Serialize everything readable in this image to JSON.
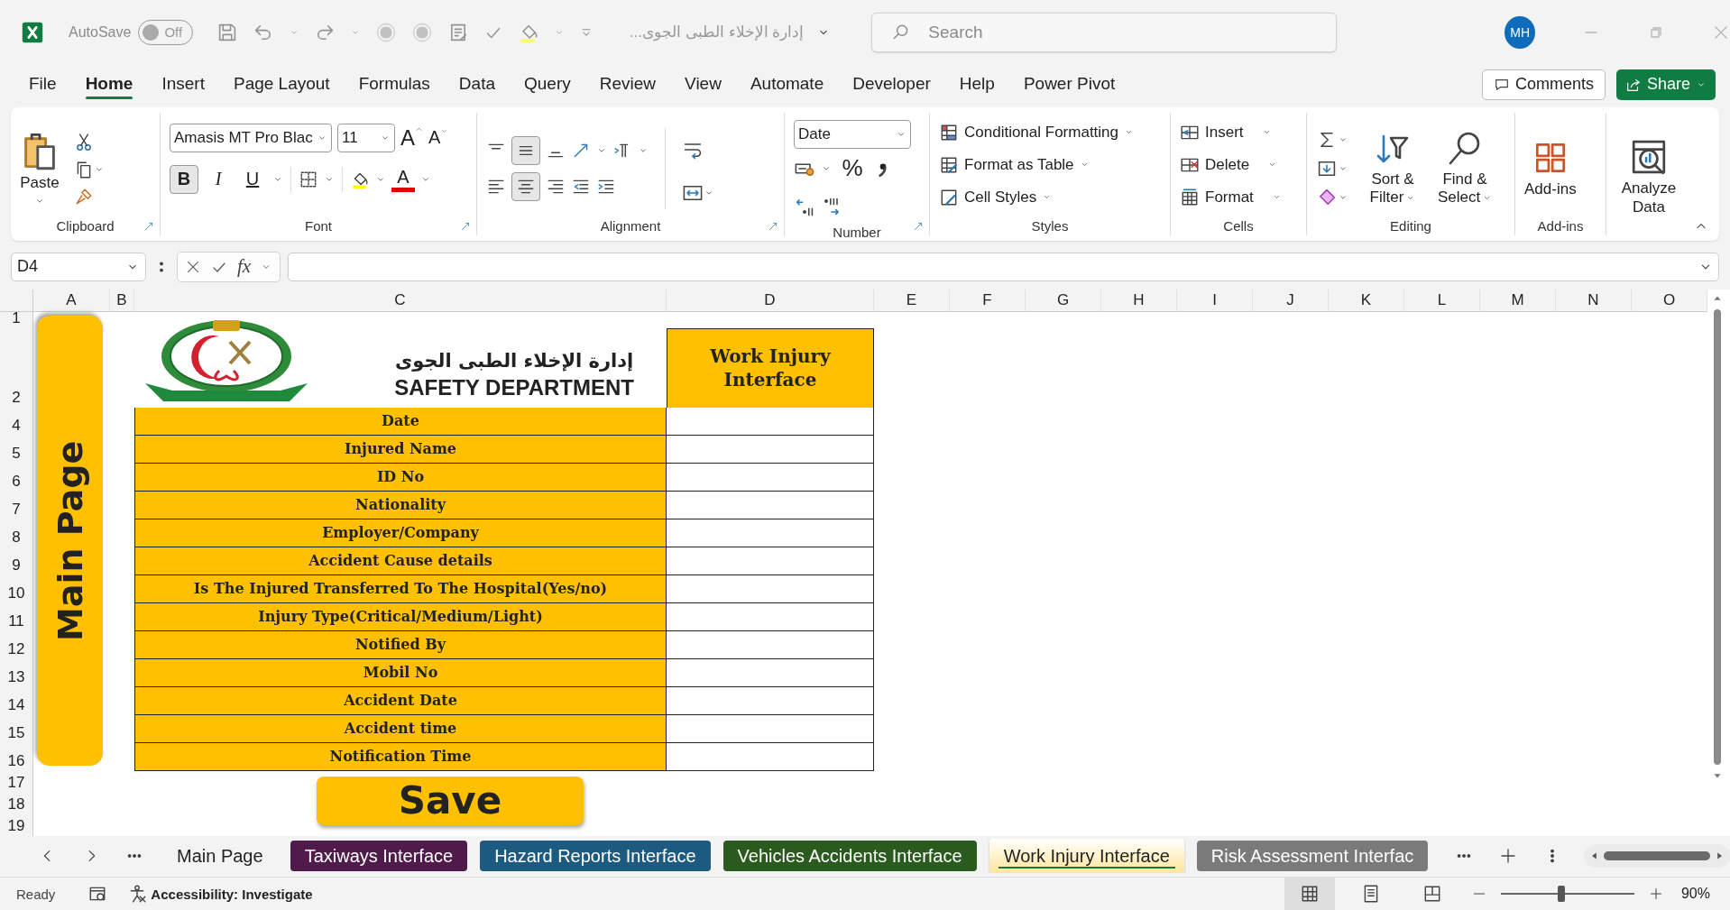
{
  "titlebar": {
    "autosave": {
      "label": "AutoSave",
      "on": false,
      "state": "Off"
    },
    "document_title": "إدارة الإخلاء الطبى الجوى...",
    "search_placeholder": "Search",
    "avatar": "MH"
  },
  "menu": [
    {
      "label": "File",
      "selected": false
    },
    {
      "label": "Home",
      "selected": true
    },
    {
      "label": "Insert",
      "selected": false
    },
    {
      "label": "Page Layout",
      "selected": false
    },
    {
      "label": "Formulas",
      "selected": false
    },
    {
      "label": "Data",
      "selected": false
    },
    {
      "label": "Query",
      "selected": false
    },
    {
      "label": "Review",
      "selected": false
    },
    {
      "label": "View",
      "selected": false
    },
    {
      "label": "Automate",
      "selected": false
    },
    {
      "label": "Developer",
      "selected": false
    },
    {
      "label": "Help",
      "selected": false
    },
    {
      "label": "Power Pivot",
      "selected": false
    }
  ],
  "actions": {
    "comments": "Comments",
    "share": "Share"
  },
  "ribbon": {
    "clipboard": {
      "paste": "Paste",
      "label": "Clipboard"
    },
    "font": {
      "name": "Amasis MT Pro Blac",
      "size": "11",
      "grow": "A",
      "shrink": "A",
      "bold": "B",
      "bold_selected": true,
      "italic": "I",
      "underline": "U",
      "color_letter": "A",
      "label": "Font"
    },
    "alignment": {
      "middle_selected": true,
      "center_selected": true,
      "label": "Alignment"
    },
    "number": {
      "format": "Date",
      "percent": "%",
      "label": "Number"
    },
    "styles": {
      "items": [
        "Conditional Formatting",
        "Format as Table",
        "Cell Styles"
      ],
      "label": "Styles"
    },
    "cells": {
      "items": [
        "Insert",
        "Delete",
        "Format"
      ],
      "label": "Cells"
    },
    "editing": {
      "sort_filter": "Sort & Filter",
      "find_select": "Find & Select",
      "label": "Editing"
    },
    "addins": {
      "button": "Add-ins",
      "label": "Add-ins"
    },
    "analyze": "Analyze Data"
  },
  "formula_bar": {
    "name_box": "D4",
    "fx": "fx"
  },
  "sheet": {
    "columns": [
      "A",
      "B",
      "C",
      "D",
      "E",
      "F",
      "G",
      "H",
      "I",
      "J",
      "K",
      "L",
      "M",
      "N",
      "O"
    ],
    "rows": [
      "1",
      "2",
      "4",
      "5",
      "6",
      "7",
      "8",
      "9",
      "10",
      "11",
      "12",
      "13",
      "14",
      "15",
      "16",
      "17",
      "18",
      "19"
    ],
    "main_page_button": "Main Page",
    "arabic_title": "إدارة الإخلاء الطبى الجوى",
    "english_title": "SAFETY DEPARTMENT",
    "form_title": "Work Injury Interface",
    "fields": [
      "Date",
      "Injured Name",
      "ID No",
      "Nationality",
      "Employer/Company",
      "Accident Cause details",
      "Is The Injured Transferred To The Hospital(Yes/no)",
      "Injury Type(Critical/Medium/Light)",
      "Notified By",
      "Mobil No",
      "Accident Date",
      "Accident time",
      "Notification Time"
    ],
    "save_button": "Save"
  },
  "sheet_tabs": [
    {
      "label": "Main Page",
      "selected": false
    },
    {
      "label": "Taxiways Interface",
      "selected": false,
      "color": "#4f1b4b"
    },
    {
      "label": "Hazard Reports Interface",
      "selected": false,
      "color": "#1c5a80"
    },
    {
      "label": "Vehicles Accidents Interface",
      "selected": false,
      "color": "#2a5a1e"
    },
    {
      "label": "Work Injury Interface",
      "selected": true,
      "color": "#ffe699"
    },
    {
      "label": "Risk Assessment Interfac",
      "selected": false,
      "color": "#7a7a7a"
    }
  ],
  "status_bar": {
    "ready": "Ready",
    "accessibility": "Accessibility: Investigate",
    "views": [
      {
        "kind": "normal",
        "selected": true
      },
      {
        "kind": "page_layout",
        "selected": false
      },
      {
        "kind": "page_break",
        "selected": false
      }
    ],
    "zoom_slider": {
      "level": 0.45
    },
    "zoom": "90%"
  }
}
